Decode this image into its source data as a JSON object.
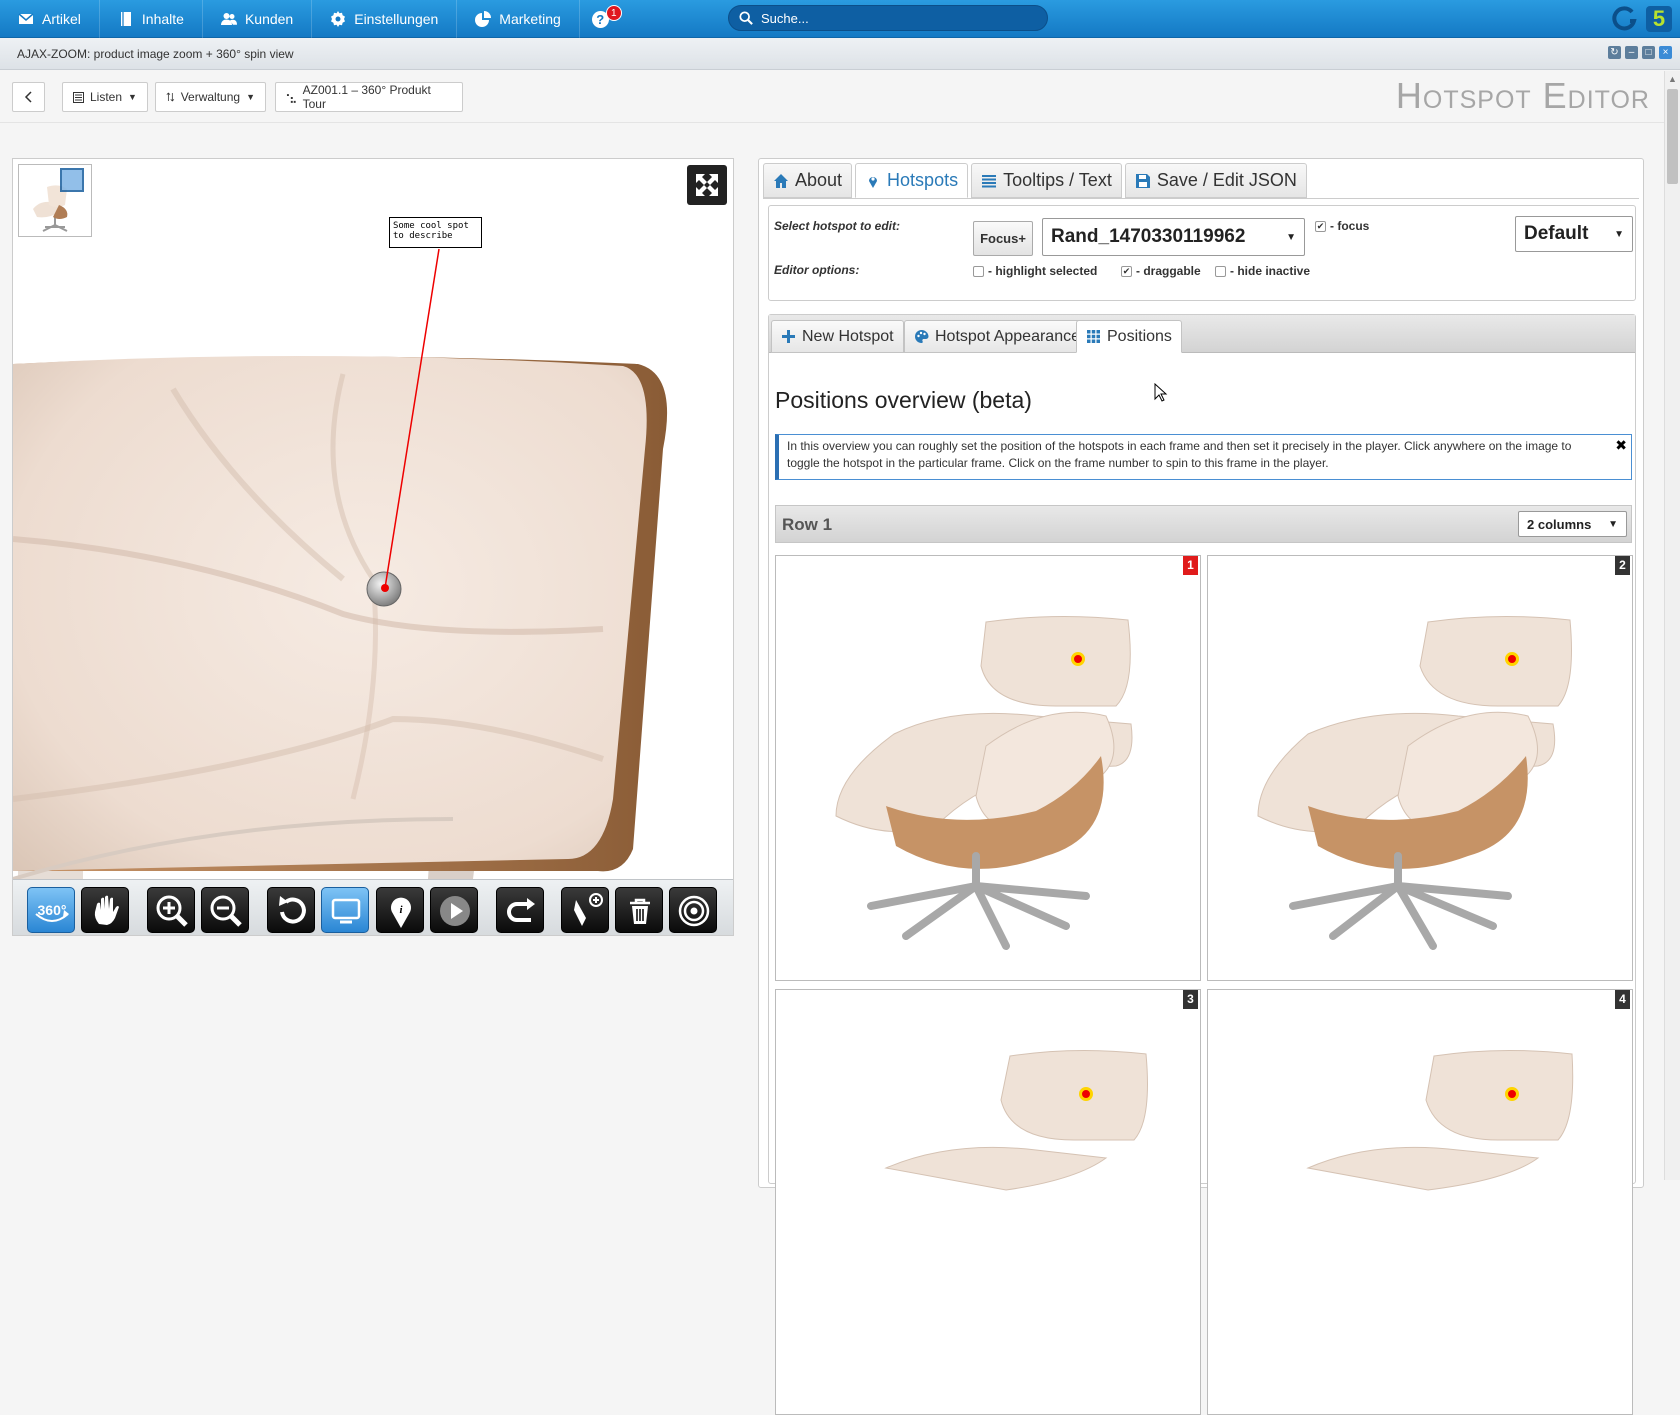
{
  "topnav": {
    "items": [
      {
        "label": "Artikel",
        "icon": "mail-icon"
      },
      {
        "label": "Inhalte",
        "icon": "book-icon"
      },
      {
        "label": "Kunden",
        "icon": "users-icon"
      },
      {
        "label": "Einstellungen",
        "icon": "gear-icon"
      },
      {
        "label": "Marketing",
        "icon": "pie-chart-icon"
      }
    ],
    "help_badge": "1",
    "search_placeholder": "Suche...",
    "accent": "#1a87d3"
  },
  "window": {
    "title": "AJAX-ZOOM: product image zoom + 360° spin view"
  },
  "toolbar": {
    "back_icon": "chevron-left-icon",
    "listen_label": "Listen",
    "verwaltung_label": "Verwaltung",
    "product_label": "AZ001.1 – 360° Produkt Tour",
    "page_title": "Hotspot Editor"
  },
  "viewer": {
    "tooltip_text": "Some cool spot\nto describe",
    "buttons": [
      {
        "name": "spin-360-icon",
        "active": true
      },
      {
        "name": "pan-hand-icon",
        "active": false
      },
      {
        "name": "zoom-in-icon",
        "active": false
      },
      {
        "name": "zoom-out-icon",
        "active": false
      },
      {
        "name": "reset-icon",
        "active": false
      },
      {
        "name": "screen-icon",
        "active": true
      },
      {
        "name": "map-pin-icon",
        "active": false
      },
      {
        "name": "play-icon",
        "active": false
      },
      {
        "name": "redo-icon",
        "active": false
      },
      {
        "name": "add-hotspot-icon",
        "active": false
      },
      {
        "name": "trash-icon",
        "active": false
      },
      {
        "name": "target-icon",
        "active": false
      }
    ]
  },
  "panel": {
    "tabs": [
      {
        "label": "About",
        "icon": "home-icon"
      },
      {
        "label": "Hotspots",
        "icon": "map-pin-icon"
      },
      {
        "label": "Tooltips / Text",
        "icon": "list-icon"
      },
      {
        "label": "Save / Edit JSON",
        "icon": "save-icon"
      }
    ],
    "select_label": "Select hotspot to edit:",
    "focus_button": "Focus+",
    "hotspot_value": "Rand_1470330119962",
    "focus_label": "- focus",
    "focus_checked": true,
    "preset_value": "Default",
    "editor_options_label": "Editor options:",
    "options": [
      {
        "label": "- highlight selected",
        "checked": false
      },
      {
        "label": "- draggable",
        "checked": true
      },
      {
        "label": "- hide inactive",
        "checked": false
      }
    ],
    "subtabs": [
      {
        "label": "New Hotspot",
        "icon": "plus-icon"
      },
      {
        "label": "Hotspot Appearance",
        "icon": "palette-icon"
      },
      {
        "label": "Positions",
        "icon": "grid-icon"
      }
    ],
    "positions_title": "Positions overview (beta)",
    "info_text": "In this overview you can roughly set the position of the hotspots in each frame and then set it precisely in the player. Click anywhere on the image to toggle the hotspot in the particular frame. Click on the frame number to spin to this frame in the player.",
    "row_title": "Row 1",
    "columns_value": "2 columns",
    "frames": [
      "1",
      "2",
      "3",
      "4"
    ]
  }
}
